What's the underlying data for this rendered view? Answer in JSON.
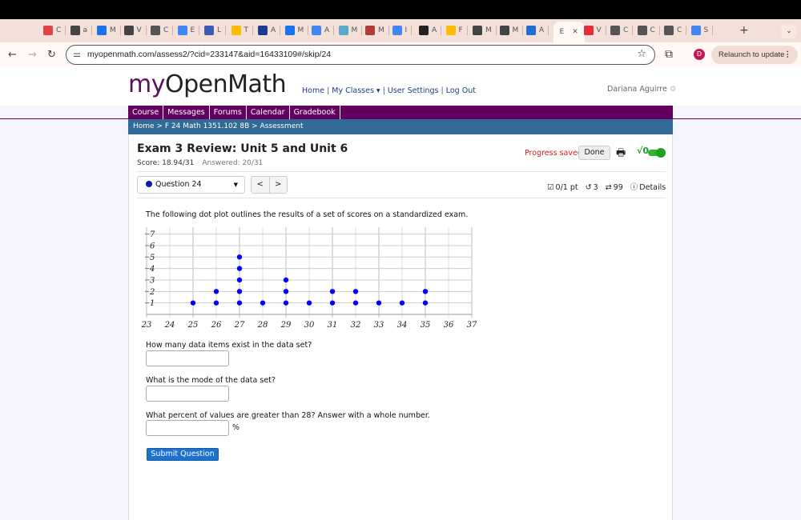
{
  "browser": {
    "tabs": [
      {
        "label": "C",
        "icon": "red-dotted-circle-icon",
        "color": "#e04343"
      },
      {
        "label": "a",
        "icon": "globe-icon",
        "color": "#444444"
      },
      {
        "label": "M",
        "icon": "outlook-icon",
        "color": "#1a73e8"
      },
      {
        "label": "V",
        "icon": "globe-icon",
        "color": "#444444"
      },
      {
        "label": "C",
        "icon": "openai-icon",
        "color": "#555555"
      },
      {
        "label": "E",
        "icon": "google-docs-icon",
        "color": "#4285f4"
      },
      {
        "label": "L",
        "icon": "forms-icon",
        "color": "#3b5bb5"
      },
      {
        "label": "T",
        "icon": "google-drive-icon",
        "color": "#fbbc04"
      },
      {
        "label": "A",
        "icon": "flag-icon",
        "color": "#1d3b8f"
      },
      {
        "label": "M",
        "icon": "google-meet-icon",
        "color": "#1a73e8"
      },
      {
        "label": "A",
        "icon": "google-icon",
        "color": "#4285f4"
      },
      {
        "label": "M",
        "icon": "brain-icon",
        "color": "#5aa9c8"
      },
      {
        "label": "M",
        "icon": "book-icon",
        "color": "#b13b3b"
      },
      {
        "label": "I",
        "icon": "google-docs-icon",
        "color": "#4285f4"
      },
      {
        "label": "A",
        "icon": "amazon-icon",
        "color": "#222222"
      },
      {
        "label": "F",
        "icon": "google-drive-icon",
        "color": "#fbbc04"
      },
      {
        "label": "M",
        "icon": "chrome-icon",
        "color": "#444444"
      },
      {
        "label": "M",
        "icon": "chrome-icon",
        "color": "#444444"
      },
      {
        "label": "A",
        "icon": "app-icon",
        "color": "#1f6fd1"
      },
      {
        "label": "E",
        "icon": "active-tab",
        "color": "#ffffff",
        "active": true
      },
      {
        "label": "V",
        "icon": "x-app-icon",
        "color": "#e52d3a"
      },
      {
        "label": "C",
        "icon": "openai-icon",
        "color": "#555555"
      },
      {
        "label": "C",
        "icon": "openai-icon",
        "color": "#555555"
      },
      {
        "label": "C",
        "icon": "openai-icon",
        "color": "#555555"
      },
      {
        "label": "S",
        "icon": "google-icon",
        "color": "#4285f4"
      }
    ],
    "new_tab": "+",
    "tab_menu": "⌄",
    "url": "myopenmath.com/assess2/?cid=233147&aid=16433109#/skip/24",
    "profile_initial": "D",
    "relaunch_label": "Relaunch to update"
  },
  "site": {
    "logo_my": "my",
    "logo_open": "OpenMath",
    "toplinks": [
      "Home",
      "My Classes ▾",
      "User Settings",
      "Log Out"
    ],
    "username": "Dariana Aguirre",
    "nav": [
      "Course",
      "Messages",
      "Forums",
      "Calendar",
      "Gradebook"
    ],
    "breadcrumb": {
      "home": "Home",
      "sep": " > ",
      "course": "F 24 Math 1351.102 8B",
      "current": "Assessment"
    }
  },
  "assessment": {
    "title": "Exam 3 Review: Unit 5 and Unit 6",
    "score": "Score: 18.94/31",
    "answered": "Answered: 20/31",
    "progress_saved": "Progress saved",
    "done_label": "Done",
    "math_toggle_label": "√0",
    "question_select": "Question 24",
    "prev": "<",
    "next": ">",
    "points": "0/1 pt",
    "retries": "3",
    "attempts": "99",
    "details": "Details"
  },
  "question": {
    "prompt": "The following dot plot outlines the results of a set of scores on a standardized exam.",
    "parts": [
      {
        "label": "How many data items exist in the data set?",
        "value": "",
        "suffix": ""
      },
      {
        "label": "What is the mode of the data set?",
        "value": "",
        "suffix": ""
      },
      {
        "label": "What percent of values are greater than 28? Answer with a whole number.",
        "value": "",
        "suffix": "%"
      }
    ],
    "submit_label": "Submit Question"
  },
  "chart_data": {
    "type": "scatter",
    "subtype": "dot plot",
    "title": "",
    "xlabel": "",
    "ylabel": "",
    "x": [
      25,
      26,
      27,
      28,
      29,
      30,
      31,
      32,
      33,
      34,
      35
    ],
    "counts": [
      1,
      2,
      5,
      1,
      3,
      1,
      2,
      2,
      1,
      1,
      2
    ],
    "xlim": [
      23,
      37
    ],
    "ylim": [
      0,
      7
    ],
    "x_ticks": [
      23,
      24,
      25,
      26,
      27,
      28,
      29,
      30,
      31,
      32,
      33,
      34,
      35,
      36,
      37
    ],
    "y_ticks": [
      1,
      2,
      3,
      4,
      5,
      6,
      7
    ],
    "grid": true,
    "dot_color": "#0000ff"
  }
}
